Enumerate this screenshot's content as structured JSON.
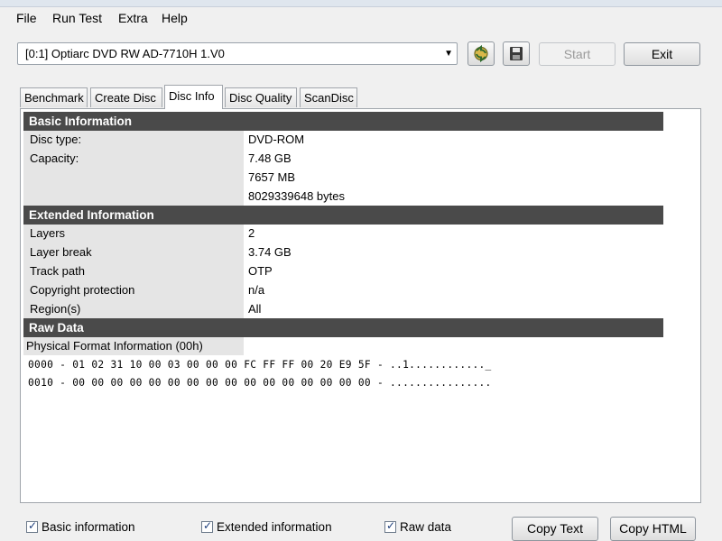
{
  "menu": [
    "File",
    "Run Test",
    "Extra",
    "Help"
  ],
  "device": {
    "selected": "[0:1]  Optiarc DVD RW AD-7710H 1.V0"
  },
  "toolbar": {
    "start_label": "Start",
    "exit_label": "Exit"
  },
  "tabs": [
    "Benchmark",
    "Create Disc",
    "Disc Info",
    "Disc Quality",
    "ScanDisc"
  ],
  "basic": {
    "title": "Basic Information",
    "disc_type_label": "Disc type:",
    "disc_type_value": "DVD-ROM",
    "capacity_label": "Capacity:",
    "capacity_gb": "7.48 GB",
    "capacity_mb": "7657 MB",
    "capacity_bytes": "8029339648 bytes"
  },
  "extended": {
    "title": "Extended Information",
    "rows": [
      {
        "label": "Layers",
        "value": "2"
      },
      {
        "label": "Layer break",
        "value": "3.74 GB"
      },
      {
        "label": "Track path",
        "value": "OTP"
      },
      {
        "label": "Copyright protection",
        "value": "n/a"
      },
      {
        "label": "Region(s)",
        "value": "All"
      }
    ]
  },
  "raw": {
    "title": "Raw Data",
    "pfi_label": "Physical Format Information (00h)",
    "lines": [
      "0000 - 01 02 31 10 00 03 00 00 00 FC FF FF 00 20 E9 5F - ..1............_",
      "0010 - 00 00 00 00 00 00 00 00 00 00 00 00 00 00 00 00 - ................"
    ]
  },
  "bottom": {
    "checks": [
      "Basic information",
      "Extended information",
      "Raw data"
    ],
    "copy_text": "Copy Text",
    "copy_html": "Copy HTML"
  }
}
